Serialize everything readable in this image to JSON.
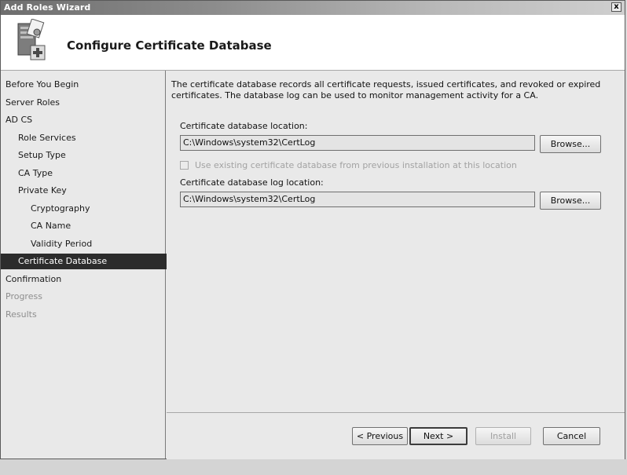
{
  "window": {
    "title": "Add Roles Wizard",
    "close_glyph": "x"
  },
  "header": {
    "title": "Configure Certificate Database",
    "icon": "certificate-server-add-icon"
  },
  "sidebar": {
    "items": [
      {
        "label": "Before You Begin"
      },
      {
        "label": "Server Roles"
      },
      {
        "label": "AD CS"
      },
      {
        "label": "Role Services"
      },
      {
        "label": "Setup Type"
      },
      {
        "label": "CA Type"
      },
      {
        "label": "Private Key"
      },
      {
        "label": "Cryptography"
      },
      {
        "label": "CA Name"
      },
      {
        "label": "Validity Period"
      },
      {
        "label": "Certificate Database"
      },
      {
        "label": "Confirmation"
      },
      {
        "label": "Progress"
      },
      {
        "label": "Results"
      }
    ]
  },
  "main": {
    "description": "The certificate database records all certificate requests, issued certificates, and revoked or expired certificates. The database log can be used to monitor management activity for a CA.",
    "db_location_label": "Certificate database location:",
    "db_location_value": "C:\\Windows\\system32\\CertLog",
    "browse_label": "Browse...",
    "use_existing_label": "Use existing certificate database from previous installation at this location",
    "log_location_label": "Certificate database log location:",
    "log_location_value": "C:\\Windows\\system32\\CertLog"
  },
  "footer": {
    "previous_label": "< Previous",
    "next_label": "Next >",
    "install_label": "Install",
    "cancel_label": "Cancel"
  }
}
